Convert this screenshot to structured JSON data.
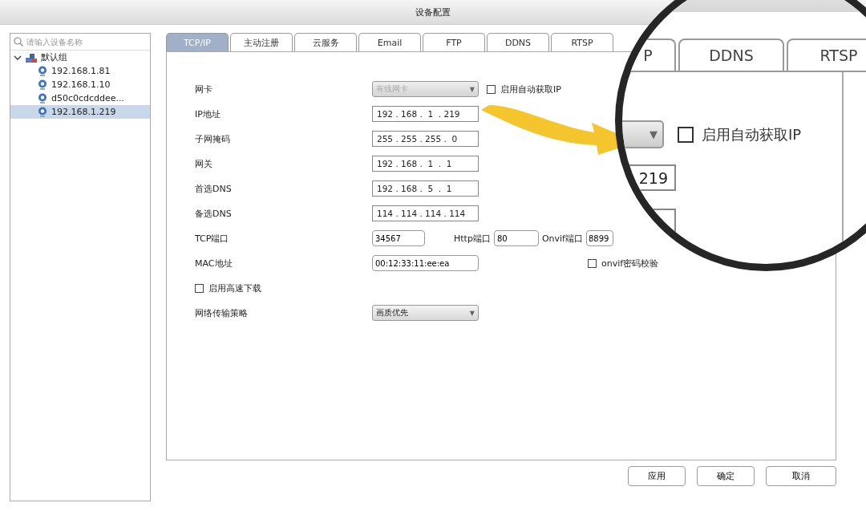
{
  "window": {
    "title": "设备配置"
  },
  "device_tree": {
    "placeholder": "请输入设备名称",
    "groups": [
      {
        "label": "默认组",
        "expanded": true,
        "children": [
          {
            "label": "192.168.1.81",
            "selected": false
          },
          {
            "label": "192.168.1.10",
            "selected": false
          },
          {
            "label": "d50c0cdcddee...",
            "selected": false
          },
          {
            "label": "192.168.1.219",
            "selected": true
          }
        ]
      }
    ]
  },
  "tabs": [
    {
      "label": "TCP/IP",
      "selected": true
    },
    {
      "label": "主动注册",
      "selected": false
    },
    {
      "label": "云服务",
      "selected": false
    },
    {
      "label": "Email",
      "selected": false
    },
    {
      "label": "FTP",
      "selected": false
    },
    {
      "label": "DDNS",
      "selected": false
    },
    {
      "label": "RTSP",
      "selected": false
    }
  ],
  "network_card": {
    "label": "网卡",
    "value": "有线网卡",
    "caret": "▼",
    "disabled": true,
    "auto_ip": {
      "label": "启用自动获取IP",
      "checked": false
    }
  },
  "ip_rows": [
    {
      "label": "IP地址",
      "value": "192 . 168 .  1  . 219"
    },
    {
      "label": "子网掩码",
      "value": "255 . 255 . 255 .  0"
    },
    {
      "label": "网关",
      "value": "192 . 168 .  1  .  1"
    },
    {
      "label": "首选DNS",
      "value": "192 . 168 .  5  .  1"
    },
    {
      "label": "备选DNS",
      "value": "114 . 114 . 114 . 114"
    }
  ],
  "ports": [
    {
      "label": "TCP端口",
      "value": "34567"
    },
    {
      "label": "Http端口",
      "value": "80"
    },
    {
      "label": "Onvif端口",
      "value": "8899"
    }
  ],
  "mac": {
    "label": "MAC地址",
    "value": "00:12:33:11:ee:ea"
  },
  "onvif_check": {
    "label": "onvif密码校验",
    "checked": false
  },
  "high_speed": {
    "label": "启用高速下载",
    "checked": false
  },
  "strategy": {
    "label": "网络传输策略",
    "value": "画质优先",
    "caret": "▼"
  },
  "buttons": [
    "应用",
    "确定",
    "取消"
  ],
  "magnifier": {
    "tabs": [
      "P",
      "DDNS",
      "RTSP"
    ],
    "caret": "▼",
    "auto_ip": {
      "label": "启用自动获取IP",
      "checked": false
    },
    "ip_tail": "219"
  }
}
